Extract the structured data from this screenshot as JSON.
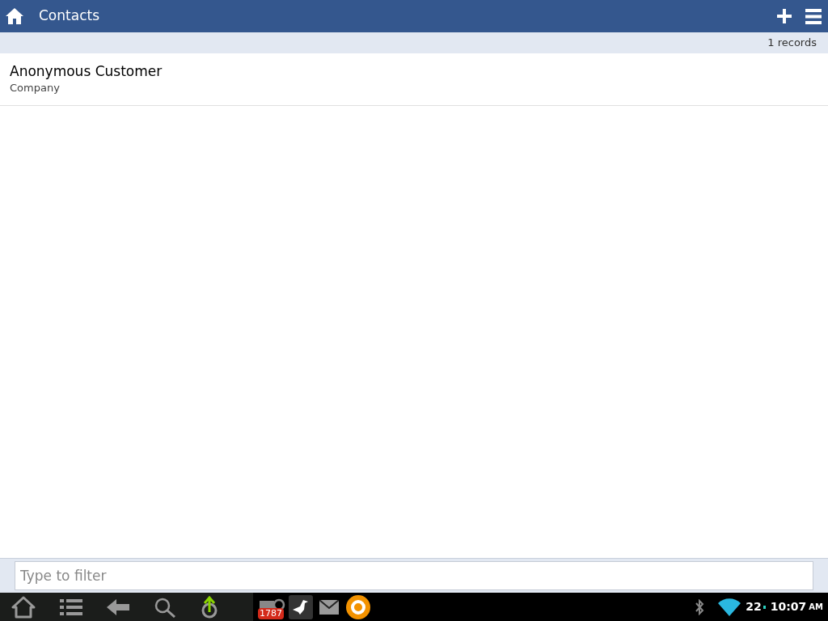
{
  "header": {
    "title": "Contacts"
  },
  "records_count": "1 records",
  "contacts": [
    {
      "name": "Anonymous Customer",
      "subtitle": "Company"
    }
  ],
  "filter": {
    "placeholder": "Type to filter"
  },
  "system_bar": {
    "mail_badge": "1787",
    "battery": "22",
    "time": "10:07",
    "ampm": "AM"
  }
}
